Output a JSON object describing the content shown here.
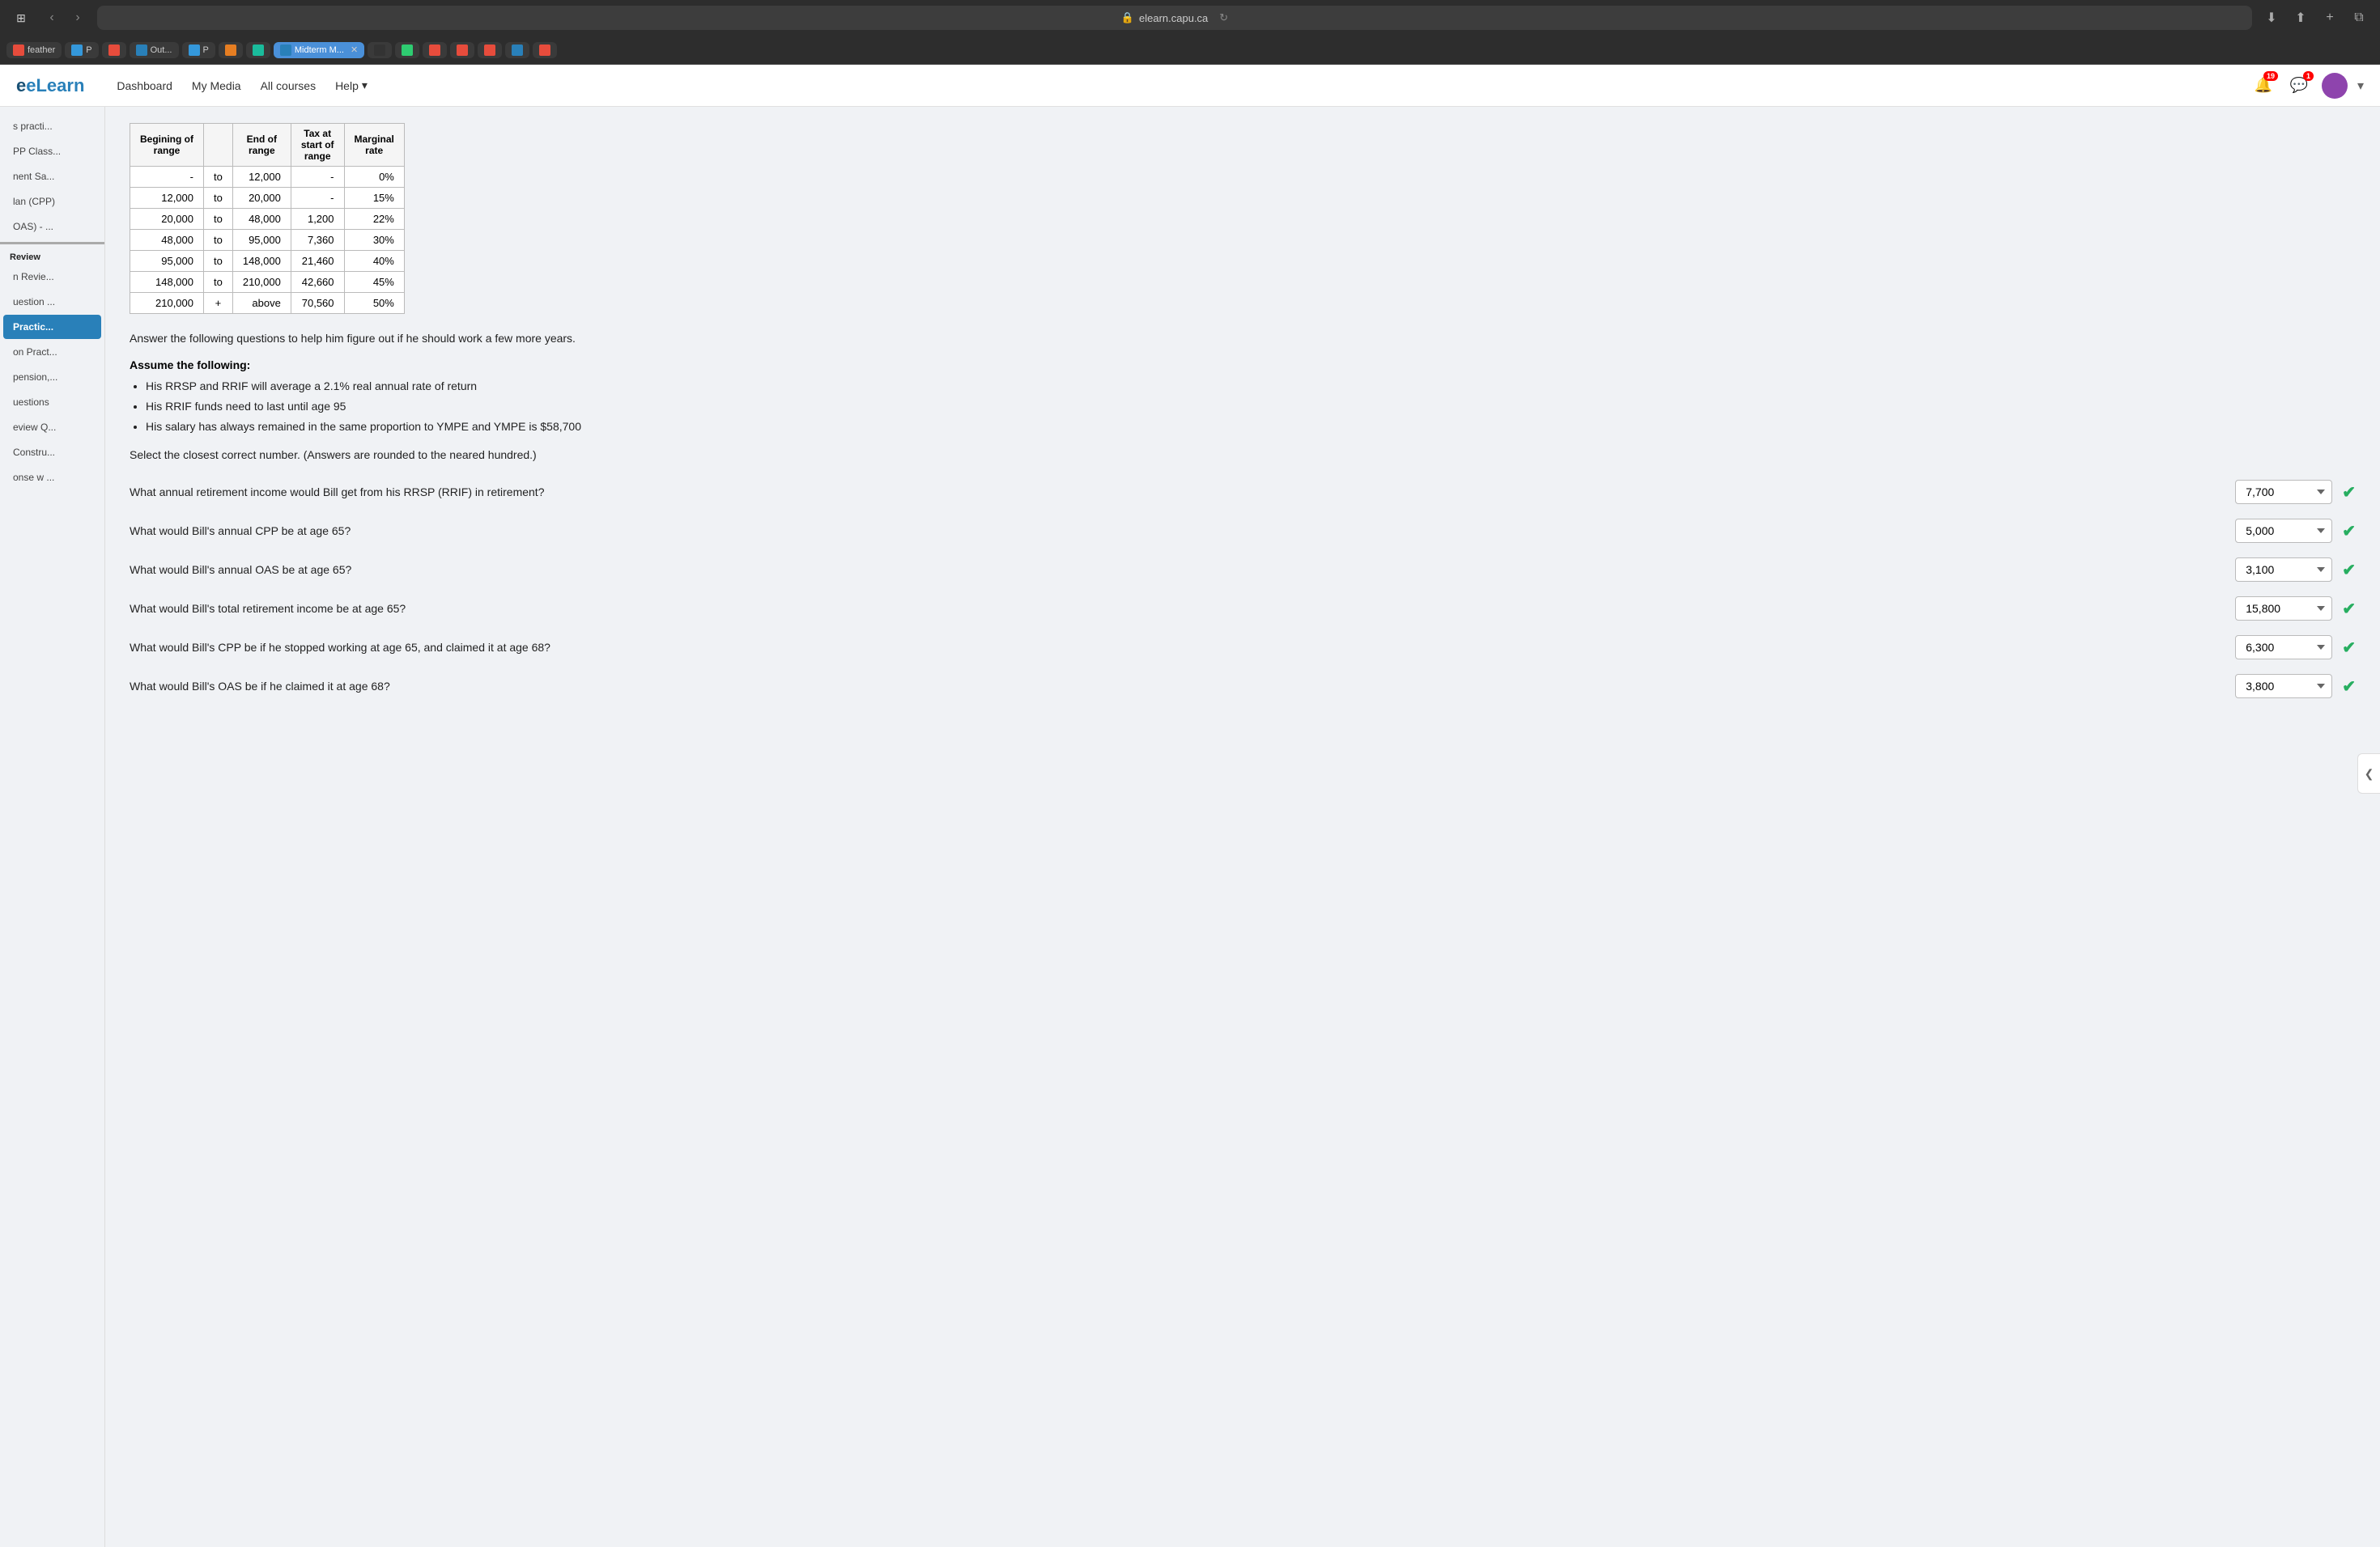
{
  "browser": {
    "url": "elearn.capu.ca",
    "reload_icon": "↻"
  },
  "nav": {
    "logo": "eLearn",
    "links": [
      "Dashboard",
      "My Media",
      "All courses",
      "Help"
    ],
    "notifications_count": "19",
    "messages_count": "1"
  },
  "sidebar": {
    "items": [
      {
        "id": "s-practi",
        "label": "s practi...",
        "active": false
      },
      {
        "id": "pp-class",
        "label": "PP Class...",
        "active": false
      },
      {
        "id": "nent-sa",
        "label": "nent Sa...",
        "active": false
      },
      {
        "id": "plan-cpp",
        "label": "lan (CPP)",
        "active": false
      },
      {
        "id": "oas",
        "label": "OAS) - ...",
        "active": false
      }
    ],
    "section_review": "Review",
    "review_items": [
      {
        "id": "n-revie",
        "label": "n Revie...",
        "active": false
      },
      {
        "id": "uestion",
        "label": "uestion ...",
        "active": false
      },
      {
        "id": "practic",
        "label": "Practic...",
        "active": true
      },
      {
        "id": "on-pract",
        "label": "on Pract...",
        "active": false
      },
      {
        "id": "pension",
        "label": "pension,...",
        "active": false
      },
      {
        "id": "uestions2",
        "label": "uestions",
        "active": false
      },
      {
        "id": "eview-q",
        "label": "eview Q...",
        "active": false
      },
      {
        "id": "constru",
        "label": "Constru...",
        "active": false
      },
      {
        "id": "onse-w",
        "label": "onse w ...",
        "active": false
      }
    ]
  },
  "tax_table": {
    "headers": [
      "Begining of range",
      "",
      "End of range",
      "Tax at start of range",
      "Marginal rate"
    ],
    "rows": [
      {
        "from": "-",
        "to": "to",
        "end": "12,000",
        "tax_start": "-",
        "rate": "0%"
      },
      {
        "from": "12,000",
        "to": "to",
        "end": "20,000",
        "tax_start": "-",
        "rate": "15%"
      },
      {
        "from": "20,000",
        "to": "to",
        "end": "48,000",
        "tax_start": "1,200",
        "rate": "22%"
      },
      {
        "from": "48,000",
        "to": "to",
        "end": "95,000",
        "tax_start": "7,360",
        "rate": "30%"
      },
      {
        "from": "95,000",
        "to": "to",
        "end": "148,000",
        "tax_start": "21,460",
        "rate": "40%"
      },
      {
        "from": "148,000",
        "to": "to",
        "end": "210,000",
        "tax_start": "42,660",
        "rate": "45%"
      },
      {
        "from": "210,000",
        "to": "+",
        "end": "above",
        "tax_start": "70,560",
        "rate": "50%"
      }
    ]
  },
  "intro_text": "Answer the following questions to help him figure out if he should work a few more years.",
  "assume_heading": "Assume the following:",
  "assumptions": [
    "His RRSP and RRIF will average a 2.1% real annual rate of return",
    "His RRIF funds need to last until age 95",
    "His salary has always remained in the same proportion to YMPE and YMPE is $58,700"
  ],
  "select_note": "Select the closest correct number.   (Answers are rounded to the neared hundred.)",
  "questions": [
    {
      "id": "q1",
      "text": "What annual retirement income would Bill get from his RRSP (RRIF) in retirement?",
      "answer": "7,700",
      "correct": true
    },
    {
      "id": "q2",
      "text": "What would Bill's annual CPP be at age 65?",
      "answer": "5,000",
      "correct": true
    },
    {
      "id": "q3",
      "text": "What would Bill's annual OAS be at age 65?",
      "answer": "3,100",
      "correct": true
    },
    {
      "id": "q4",
      "text": "What would Bill's total retirement income be at age 65?",
      "answer": "15,800",
      "correct": true
    },
    {
      "id": "q5",
      "text": "What would Bill's CPP be if he stopped working at age 65, and claimed it at age 68?",
      "answer": "6,300",
      "correct": true
    },
    {
      "id": "q6",
      "text": "What would Bill's OAS be if he claimed it at age 68?",
      "answer": "3,800",
      "correct": true
    }
  ],
  "collapse_btn_label": "❮"
}
